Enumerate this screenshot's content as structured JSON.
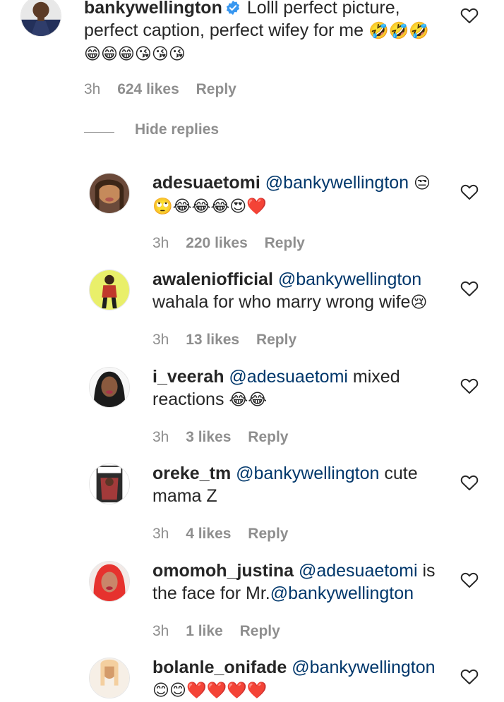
{
  "main_comment": {
    "username": "bankywellington",
    "verified": true,
    "text_line1": "Lolll perfect picture,",
    "text_line2": "perfect caption, perfect wifey for me",
    "emoji_line1": "🤣🤣🤣",
    "emoji_line2": "😁😁😁😘😘😘",
    "time": "3h",
    "likes": "624 likes",
    "reply_label": "Reply"
  },
  "hide_replies_label": "Hide replies",
  "replies": [
    {
      "username": "adesuaetomi",
      "mention": "@bankywellington",
      "emoji_after_mention": "😒",
      "text": "",
      "emoji_line": "🙄😂😂😂😍❤️",
      "time": "3h",
      "likes": "220 likes",
      "reply_label": "Reply",
      "avatar_colors": [
        "#c58a5b",
        "#3c2617"
      ]
    },
    {
      "username": "awaleniofficial",
      "mention": "@bankywellington",
      "text": "wahala for who marry wrong wife",
      "emoji_line": "😢",
      "time": "3h",
      "likes": "13 likes",
      "reply_label": "Reply",
      "avatar_colors": [
        "#e9ef6a",
        "#c0392b"
      ]
    },
    {
      "username": "i_veerah",
      "mention": "@adesuaetomi",
      "text": "mixed",
      "text2": "reactions",
      "emoji_line": "😂😂",
      "time": "3h",
      "likes": "3 likes",
      "reply_label": "Reply",
      "avatar_colors": [
        "#f7f7f7",
        "#1b1b1b"
      ]
    },
    {
      "username": "oreke_tm",
      "mention": "@bankywellington",
      "text": "cute",
      "text2": "mama Z",
      "time": "3h",
      "likes": "4 likes",
      "reply_label": "Reply",
      "avatar_colors": [
        "#2b2b2b",
        "#a23a3a"
      ]
    },
    {
      "username": "omomoh_justina",
      "mention": "@adesuaetomi",
      "text": "is",
      "text2": "the face for Mr.",
      "mention2": "@bankywellington",
      "time": "3h",
      "likes": "1 like",
      "reply_label": "Reply",
      "avatar_colors": [
        "#e6322e",
        "#f2c9a8"
      ]
    },
    {
      "username": "bolanle_onifade",
      "mention": "@bankywellington",
      "emoji_line": "😊😊❤️❤️❤️❤️",
      "avatar_colors": [
        "#f4cf9f",
        "#d49b6a"
      ]
    }
  ]
}
